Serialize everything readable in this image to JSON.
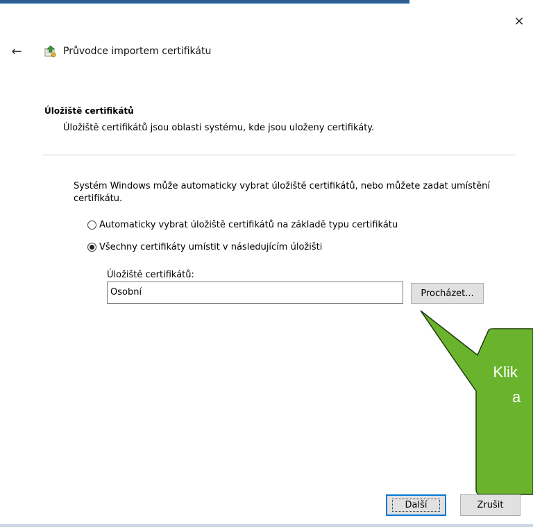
{
  "window": {
    "title": "Průvodce importem certifikátu",
    "close_glyph": "×",
    "back_glyph": "←",
    "back_icon": "back-arrow-icon",
    "wizard_icon": "certificate-wizard-icon"
  },
  "section": {
    "heading": "Úložiště certifikátů",
    "description": "Úložiště certifikátů jsou oblasti systému, kde jsou uloženy certifikáty."
  },
  "body": {
    "paragraph": "Systém Windows může automaticky vybrat úložiště certifikátů, nebo můžete zadat umístění certifikátu.",
    "radio_auto": "Automaticky vybrat úložiště certifikátů na základě typu certifikátu",
    "radio_manual": "Všechny certifikáty umístit v následujícím úložišti",
    "selected_radio": "manual",
    "store_label": "Úložiště certifikátů:",
    "store_value": "Osobní",
    "browse_button": "Procházet..."
  },
  "callout": {
    "line1": "Klik",
    "line2": "a",
    "fill_color": "#6ab42d",
    "border_color": "#1e3a0f"
  },
  "footer": {
    "next_button": "Další",
    "cancel_button": "Zrušit"
  }
}
